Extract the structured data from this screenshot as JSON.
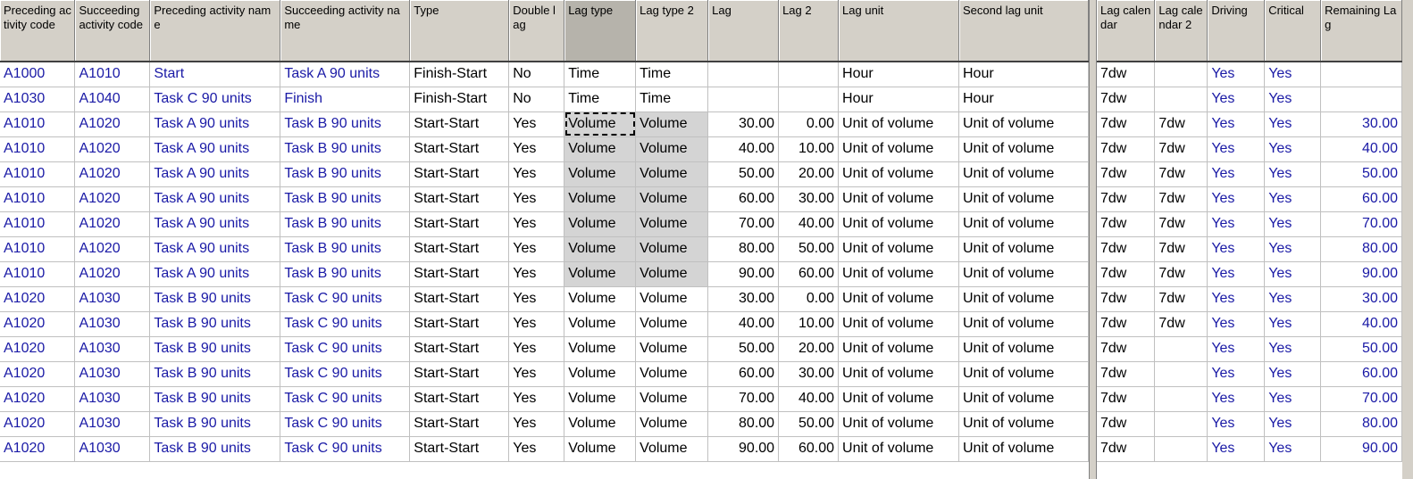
{
  "left_headers": [
    "Preceding activity code",
    "Succeeding activity code",
    "Preceding activity name",
    "Succeeding activity name",
    "Type",
    "Double lag",
    "Lag type",
    "Lag type 2",
    "Lag",
    "Lag 2",
    "Lag unit",
    "Second lag unit"
  ],
  "right_headers": [
    "Lag calendar",
    "Lag calendar 2",
    "Driving",
    "Critical",
    "Remaining Lag"
  ],
  "rows": [
    {
      "pre_code": "A1000",
      "suc_code": "A1010",
      "pre_name": "Start",
      "suc_name": "Task A 90 units",
      "type": "Finish-Start",
      "double_lag": "No",
      "lag_type": "Time",
      "lag_type2": "Time",
      "lag": "",
      "lag2": "",
      "lag_unit": "Hour",
      "lag_unit2": "Hour",
      "lag_cal": "7dw",
      "lag_cal2": "",
      "driving": "Yes",
      "critical": "Yes",
      "remaining": ""
    },
    {
      "pre_code": "A1030",
      "suc_code": "A1040",
      "pre_name": "Task C 90 units",
      "suc_name": "Finish",
      "type": "Finish-Start",
      "double_lag": "No",
      "lag_type": "Time",
      "lag_type2": "Time",
      "lag": "",
      "lag2": "",
      "lag_unit": "Hour",
      "lag_unit2": "Hour",
      "lag_cal": "7dw",
      "lag_cal2": "",
      "driving": "Yes",
      "critical": "Yes",
      "remaining": ""
    },
    {
      "pre_code": "A1010",
      "suc_code": "A1020",
      "pre_name": "Task A 90 units",
      "suc_name": "Task B 90 units",
      "type": "Start-Start",
      "double_lag": "Yes",
      "lag_type": "Volume",
      "lag_type2": "Volume",
      "lag": "30.00",
      "lag2": "0.00",
      "lag_unit": "Unit of volume",
      "lag_unit2": "Unit of volume",
      "lag_cal": "7dw",
      "lag_cal2": "7dw",
      "driving": "Yes",
      "critical": "Yes",
      "remaining": "30.00"
    },
    {
      "pre_code": "A1010",
      "suc_code": "A1020",
      "pre_name": "Task A 90 units",
      "suc_name": "Task B 90 units",
      "type": "Start-Start",
      "double_lag": "Yes",
      "lag_type": "Volume",
      "lag_type2": "Volume",
      "lag": "40.00",
      "lag2": "10.00",
      "lag_unit": "Unit of volume",
      "lag_unit2": "Unit of volume",
      "lag_cal": "7dw",
      "lag_cal2": "7dw",
      "driving": "Yes",
      "critical": "Yes",
      "remaining": "40.00"
    },
    {
      "pre_code": "A1010",
      "suc_code": "A1020",
      "pre_name": "Task A 90 units",
      "suc_name": "Task B 90 units",
      "type": "Start-Start",
      "double_lag": "Yes",
      "lag_type": "Volume",
      "lag_type2": "Volume",
      "lag": "50.00",
      "lag2": "20.00",
      "lag_unit": "Unit of volume",
      "lag_unit2": "Unit of volume",
      "lag_cal": "7dw",
      "lag_cal2": "7dw",
      "driving": "Yes",
      "critical": "Yes",
      "remaining": "50.00"
    },
    {
      "pre_code": "A1010",
      "suc_code": "A1020",
      "pre_name": "Task A 90 units",
      "suc_name": "Task B 90 units",
      "type": "Start-Start",
      "double_lag": "Yes",
      "lag_type": "Volume",
      "lag_type2": "Volume",
      "lag": "60.00",
      "lag2": "30.00",
      "lag_unit": "Unit of volume",
      "lag_unit2": "Unit of volume",
      "lag_cal": "7dw",
      "lag_cal2": "7dw",
      "driving": "Yes",
      "critical": "Yes",
      "remaining": "60.00"
    },
    {
      "pre_code": "A1010",
      "suc_code": "A1020",
      "pre_name": "Task A 90 units",
      "suc_name": "Task B 90 units",
      "type": "Start-Start",
      "double_lag": "Yes",
      "lag_type": "Volume",
      "lag_type2": "Volume",
      "lag": "70.00",
      "lag2": "40.00",
      "lag_unit": "Unit of volume",
      "lag_unit2": "Unit of volume",
      "lag_cal": "7dw",
      "lag_cal2": "7dw",
      "driving": "Yes",
      "critical": "Yes",
      "remaining": "70.00"
    },
    {
      "pre_code": "A1010",
      "suc_code": "A1020",
      "pre_name": "Task A 90 units",
      "suc_name": "Task B 90 units",
      "type": "Start-Start",
      "double_lag": "Yes",
      "lag_type": "Volume",
      "lag_type2": "Volume",
      "lag": "80.00",
      "lag2": "50.00",
      "lag_unit": "Unit of volume",
      "lag_unit2": "Unit of volume",
      "lag_cal": "7dw",
      "lag_cal2": "7dw",
      "driving": "Yes",
      "critical": "Yes",
      "remaining": "80.00"
    },
    {
      "pre_code": "A1010",
      "suc_code": "A1020",
      "pre_name": "Task A 90 units",
      "suc_name": "Task B 90 units",
      "type": "Start-Start",
      "double_lag": "Yes",
      "lag_type": "Volume",
      "lag_type2": "Volume",
      "lag": "90.00",
      "lag2": "60.00",
      "lag_unit": "Unit of volume",
      "lag_unit2": "Unit of volume",
      "lag_cal": "7dw",
      "lag_cal2": "7dw",
      "driving": "Yes",
      "critical": "Yes",
      "remaining": "90.00"
    },
    {
      "pre_code": "A1020",
      "suc_code": "A1030",
      "pre_name": "Task B 90 units",
      "suc_name": "Task C 90 units",
      "type": "Start-Start",
      "double_lag": "Yes",
      "lag_type": "Volume",
      "lag_type2": "Volume",
      "lag": "30.00",
      "lag2": "0.00",
      "lag_unit": "Unit of volume",
      "lag_unit2": "Unit of volume",
      "lag_cal": "7dw",
      "lag_cal2": "7dw",
      "driving": "Yes",
      "critical": "Yes",
      "remaining": "30.00"
    },
    {
      "pre_code": "A1020",
      "suc_code": "A1030",
      "pre_name": "Task B 90 units",
      "suc_name": "Task C 90 units",
      "type": "Start-Start",
      "double_lag": "Yes",
      "lag_type": "Volume",
      "lag_type2": "Volume",
      "lag": "40.00",
      "lag2": "10.00",
      "lag_unit": "Unit of volume",
      "lag_unit2": "Unit of volume",
      "lag_cal": "7dw",
      "lag_cal2": "7dw",
      "driving": "Yes",
      "critical": "Yes",
      "remaining": "40.00"
    },
    {
      "pre_code": "A1020",
      "suc_code": "A1030",
      "pre_name": "Task B 90 units",
      "suc_name": "Task C 90 units",
      "type": "Start-Start",
      "double_lag": "Yes",
      "lag_type": "Volume",
      "lag_type2": "Volume",
      "lag": "50.00",
      "lag2": "20.00",
      "lag_unit": "Unit of volume",
      "lag_unit2": "Unit of volume",
      "lag_cal": "7dw",
      "lag_cal2": "",
      "driving": "Yes",
      "critical": "Yes",
      "remaining": "50.00"
    },
    {
      "pre_code": "A1020",
      "suc_code": "A1030",
      "pre_name": "Task B 90 units",
      "suc_name": "Task C 90 units",
      "type": "Start-Start",
      "double_lag": "Yes",
      "lag_type": "Volume",
      "lag_type2": "Volume",
      "lag": "60.00",
      "lag2": "30.00",
      "lag_unit": "Unit of volume",
      "lag_unit2": "Unit of volume",
      "lag_cal": "7dw",
      "lag_cal2": "",
      "driving": "Yes",
      "critical": "Yes",
      "remaining": "60.00"
    },
    {
      "pre_code": "A1020",
      "suc_code": "A1030",
      "pre_name": "Task B 90 units",
      "suc_name": "Task C 90 units",
      "type": "Start-Start",
      "double_lag": "Yes",
      "lag_type": "Volume",
      "lag_type2": "Volume",
      "lag": "70.00",
      "lag2": "40.00",
      "lag_unit": "Unit of volume",
      "lag_unit2": "Unit of volume",
      "lag_cal": "7dw",
      "lag_cal2": "",
      "driving": "Yes",
      "critical": "Yes",
      "remaining": "70.00"
    },
    {
      "pre_code": "A1020",
      "suc_code": "A1030",
      "pre_name": "Task B 90 units",
      "suc_name": "Task C 90 units",
      "type": "Start-Start",
      "double_lag": "Yes",
      "lag_type": "Volume",
      "lag_type2": "Volume",
      "lag": "80.00",
      "lag2": "50.00",
      "lag_unit": "Unit of volume",
      "lag_unit2": "Unit of volume",
      "lag_cal": "7dw",
      "lag_cal2": "",
      "driving": "Yes",
      "critical": "Yes",
      "remaining": "80.00"
    },
    {
      "pre_code": "A1020",
      "suc_code": "A1030",
      "pre_name": "Task B 90 units",
      "suc_name": "Task C 90 units",
      "type": "Start-Start",
      "double_lag": "Yes",
      "lag_type": "Volume",
      "lag_type2": "Volume",
      "lag": "90.00",
      "lag2": "60.00",
      "lag_unit": "Unit of volume",
      "lag_unit2": "Unit of volume",
      "lag_cal": "7dw",
      "lag_cal2": "",
      "driving": "Yes",
      "critical": "Yes",
      "remaining": "90.00"
    }
  ],
  "colors": {
    "link_text": "#1a1aa6",
    "header_bg": "#d4d0c8",
    "selected_header_bg": "#b6b3ab",
    "highlight_cell_bg": "#d4d4d4"
  }
}
